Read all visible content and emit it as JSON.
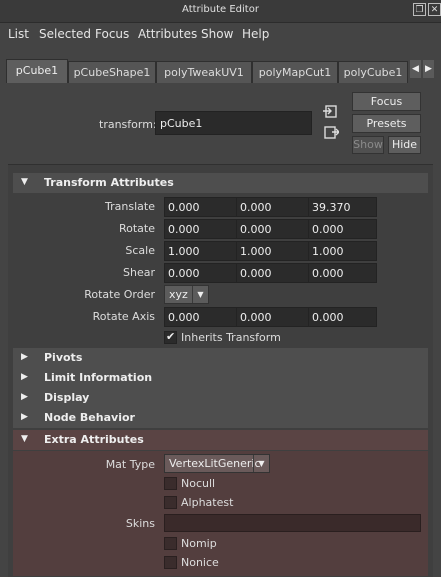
{
  "window": {
    "title": "Attribute Editor"
  },
  "menu": [
    "List",
    "Selected",
    "Focus",
    "Attributes",
    "Show",
    "Help"
  ],
  "tabs": [
    {
      "label": "pCube1",
      "active": true
    },
    {
      "label": "pCubeShape1",
      "active": false
    },
    {
      "label": "polyTweakUV1",
      "active": false
    },
    {
      "label": "polyMapCut1",
      "active": false
    },
    {
      "label": "polyCube1",
      "active": false
    }
  ],
  "node": {
    "type_label": "transform:",
    "name": "pCube1"
  },
  "buttons": {
    "focus": "Focus",
    "presets": "Presets",
    "show": "Show",
    "hide": "Hide"
  },
  "sections": {
    "transform": {
      "title": "Transform Attributes",
      "translate": {
        "label": "Translate",
        "values": [
          "0.000",
          "0.000",
          "39.370"
        ]
      },
      "rotate": {
        "label": "Rotate",
        "values": [
          "0.000",
          "0.000",
          "0.000"
        ]
      },
      "scale": {
        "label": "Scale",
        "values": [
          "1.000",
          "1.000",
          "1.000"
        ]
      },
      "shear": {
        "label": "Shear",
        "values": [
          "0.000",
          "0.000",
          "0.000"
        ]
      },
      "rotate_order": {
        "label": "Rotate Order",
        "value": "xyz"
      },
      "rotate_axis": {
        "label": "Rotate Axis",
        "values": [
          "0.000",
          "0.000",
          "0.000"
        ]
      },
      "inherits": {
        "label": "Inherits Transform",
        "checked": true
      }
    },
    "collapsed": [
      "Pivots",
      "Limit Information",
      "Display",
      "Node Behavior"
    ],
    "extra": {
      "title": "Extra Attributes",
      "mat_type": {
        "label": "Mat Type",
        "value": "VertexLitGeneric"
      },
      "nocull": {
        "label": "Nocull",
        "checked": false
      },
      "alphatest": {
        "label": "Alphatest",
        "checked": false
      },
      "skins": {
        "label": "Skins",
        "value": ""
      },
      "nomip": {
        "label": "Nomip",
        "checked": false
      },
      "nonice": {
        "label": "Nonice",
        "checked": false
      }
    }
  },
  "colors": {
    "extra_section_bg": "#533e3e",
    "panel_bg": "#444444",
    "field_bg": "#2b2b2b"
  },
  "icons": [
    "restore-icon",
    "close-icon",
    "scroll-left-icon",
    "scroll-right-icon",
    "load-node-icon",
    "select-node-icon",
    "expand-arrow-icon",
    "collapse-arrow-icon",
    "dropdown-caret-icon",
    "checkmark-icon"
  ]
}
